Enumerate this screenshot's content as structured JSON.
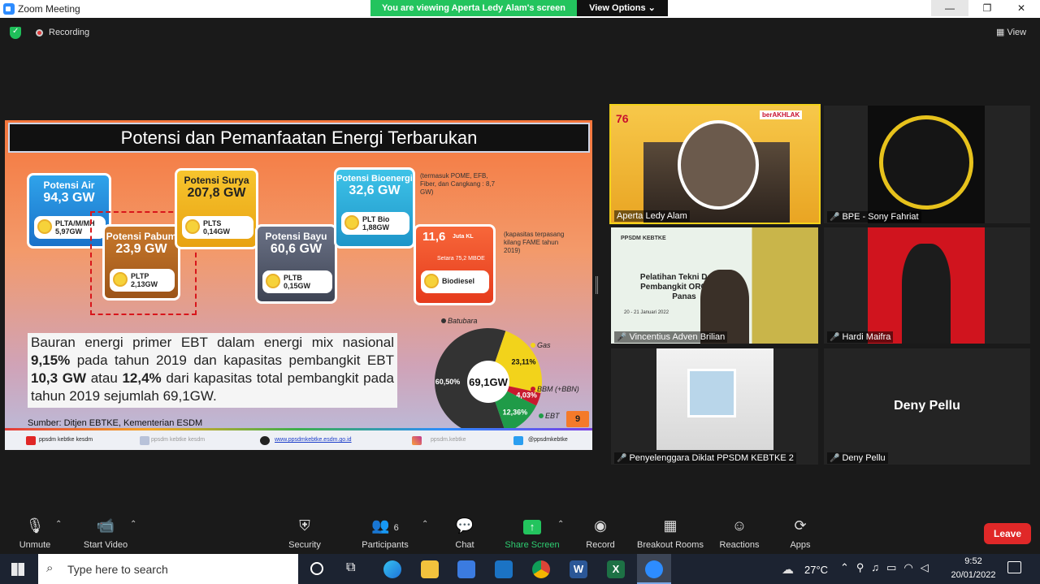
{
  "window": {
    "title": "Zoom Meeting",
    "banner": "You are viewing Aperta Ledy Alam's screen",
    "view_options": "View Options",
    "minimize": "—",
    "maximize": "❐",
    "close": "✕"
  },
  "meeting": {
    "recording": "Recording",
    "view": "View"
  },
  "slide": {
    "title": "Potensi dan Pemanfaatan Energi Terbarukan",
    "cards": [
      {
        "heading": "Potensi Air",
        "value": "94,3 GW",
        "plant": "PLTA/M/MH",
        "used": "5,97GW"
      },
      {
        "heading": "Potensi Pabum",
        "value": "23,9 GW",
        "plant": "PLTP",
        "used": "2,13GW"
      },
      {
        "heading": "Potensi Surya",
        "value": "207,8 GW",
        "plant": "PLTS",
        "used": "0,14GW"
      },
      {
        "heading": "Potensi Bayu",
        "value": "60,6 GW",
        "plant": "PLTB",
        "used": "0,15GW"
      },
      {
        "heading": "Potensi Bioenergi",
        "value": "32,6 GW",
        "plant": "PLT Bio",
        "used": "1,88GW"
      },
      {
        "heading": "11,6",
        "unit": "Juta KL",
        "sub": "Setara 75,2 MBOE",
        "plant": "Biodiesel"
      }
    ],
    "bio_note": "(termasuk POME, EFB, Fiber, dan Cangkang : 8,7 GW)",
    "biodiesel_note": "(kapasitas terpasang kilang FAME tahun 2019)",
    "paragraph_parts": [
      "Bauran energi primer EBT dalam energi mix nasional ",
      "9,15%",
      " pada tahun 2019 dan kapasitas pembangkit EBT ",
      "10,3 GW",
      " atau ",
      "12,4%",
      " dari kapasitas total pembangkit pada tahun 2019 sejumlah 69,1GW."
    ],
    "source": "Sumber: Ditjen EBTKE, Kementerian ESDM",
    "page": "9",
    "footer": {
      "youtube": "ppsdm kebtke kesdm",
      "facebook": "ppsdm kebtke kesdm",
      "web": "www.ppsdmkebtke.esdm.go.id",
      "instagram": "ppsdm.kebtke",
      "twitter": "@ppsdmkebtke"
    }
  },
  "chart_data": {
    "type": "pie",
    "center_label": "69,1GW",
    "categories": [
      "Batubara",
      "Gas",
      "BBM (+BBN)",
      "EBT"
    ],
    "values": [
      60.5,
      23.11,
      4.03,
      12.36
    ],
    "value_labels": [
      "60,50%",
      "23,11%",
      "4,03%",
      "12,36%"
    ],
    "colors": [
      "#333333",
      "#f2d31b",
      "#c8192e",
      "#1f9b48"
    ]
  },
  "participants": [
    {
      "name": "Aperta Ledy Alam",
      "muted": false
    },
    {
      "name": "BPE - Sony Fahriat",
      "muted": true
    },
    {
      "name": "Vincentius Adven Brilian",
      "muted": true
    },
    {
      "name": "Hardi Maifra",
      "muted": true
    },
    {
      "name": "Penyelenggara Diklat PPSDM KEBTKE 2",
      "muted": true
    },
    {
      "name": "Deny Pellu",
      "muted": true
    }
  ],
  "tile_texts": {
    "berakhlak": "berAKHLAK",
    "ppsdm": "PPSDM KEBTKE",
    "training": "Pelatihan Tekni Desain Pembangkit ORC pada Panas",
    "dates": "20 - 21 Januari 2022",
    "deny_big": "Deny Pellu"
  },
  "toolbar": {
    "unmute": "Unmute",
    "start_video": "Start Video",
    "security": "Security",
    "participants": "Participants",
    "participant_count": "6",
    "chat": "Chat",
    "share_screen": "Share Screen",
    "record": "Record",
    "breakout": "Breakout Rooms",
    "reactions": "Reactions",
    "apps": "Apps",
    "leave": "Leave"
  },
  "taskbar": {
    "search_placeholder": "Type here to search",
    "weather": "27°C",
    "time": "9:52",
    "date": "20/01/2022"
  }
}
